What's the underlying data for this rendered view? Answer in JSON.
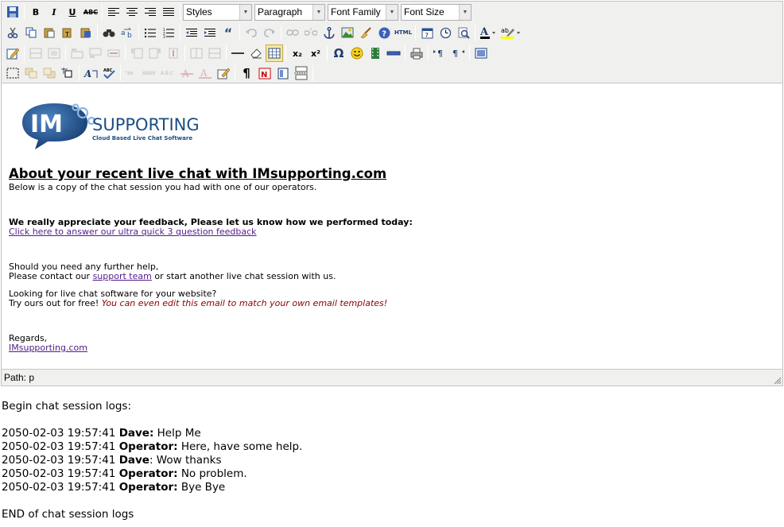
{
  "toolbar": {
    "styles_label": "Styles",
    "format_label": "Paragraph",
    "font_family_label": "Font Family",
    "font_size_label": "Font Size",
    "bold": "B",
    "italic": "I",
    "underline": "U",
    "strike": "ABC",
    "blockquote": "“",
    "omega": "Ω",
    "sub": "x₂",
    "sup": "x²",
    "para": "¶",
    "html": "HTML"
  },
  "content": {
    "heading": "About your recent live chat with IMsupporting.com",
    "subheading": "Below is a copy of the chat session you had with one of our operators.",
    "feedback_bold": "We really appreciate your feedback, Please let us know how we performed today:",
    "feedback_link": "Click here to answer our ultra quick 3 question feedback",
    "help_line1": "Should you need any further help,",
    "help_line2_pre": "Please contact our ",
    "help_line2_link": "support team",
    "help_line2_post": " or start another live chat session with us.",
    "looking_line": "Looking for live chat software for your website?",
    "try_pre": "Try ours out for free! ",
    "try_ital": "You can even edit this email to match your own email templates!",
    "regards": "Regards,",
    "site_link": "IMsupporting.com"
  },
  "logo": {
    "im": "IM",
    "supporting": "SUPPORTING",
    "tagline": "Cloud Based Live Chat Software"
  },
  "status": {
    "path": "Path: p"
  },
  "logs": {
    "begin": "Begin chat session logs:",
    "entries": [
      {
        "time": "2050-02-03 19:57:41",
        "name": "Dave:",
        "text": " Help Me"
      },
      {
        "time": "2050-02-03 19:57:41",
        "name": "Operator:",
        "text": " Here, have some help."
      },
      {
        "time": "2050-02-03 19:57:41",
        "name": "Dave",
        "text": ": Wow thanks"
      },
      {
        "time": "2050-02-03 19:57:41",
        "name": "Operator:",
        "text": " No problem."
      },
      {
        "time": "2050-02-03 19:57:41",
        "name": "Operator:",
        "text": " Bye Bye"
      }
    ],
    "end": "END of chat session logs"
  },
  "colors": {
    "toolbar_bg": "#f0f0ee",
    "logo_blue": "#1b4e86",
    "link": "#551a8b",
    "accent_red": "#8b0000"
  }
}
